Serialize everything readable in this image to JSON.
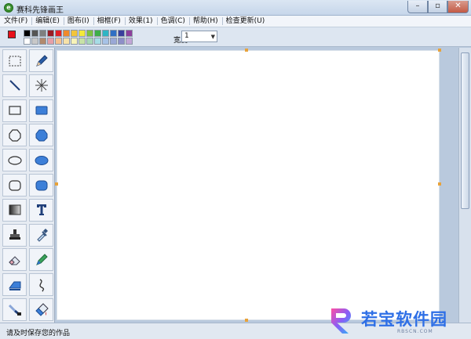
{
  "window": {
    "title": "赛科先锋画王"
  },
  "menu": [
    "文件(F)",
    "编辑(E)",
    "图布(I)",
    "相框(F)",
    "效果(1)",
    "色调(C)",
    "帮助(H)",
    "检查更新(U)"
  ],
  "toolbar": {
    "width_label": "宽度:",
    "width_value": "1",
    "foreground_color": "#e8101a",
    "background_color": "#111111",
    "palette": [
      "#000000",
      "#808080",
      "#800000",
      "#808000",
      "#008000",
      "#008080",
      "#000080",
      "#800080",
      "#808040",
      "#004040",
      "#0080ff",
      "#004080",
      "#8000ff",
      "#804000",
      "#ffffff",
      "#c0c0c0",
      "#ff0000",
      "#ffff00",
      "#00ff00",
      "#00ffff",
      "#0000ff",
      "#ff00ff",
      "#ffff80",
      "#00ff80",
      "#80ffff",
      "#8080ff",
      "#ff0080",
      "#ff8040"
    ],
    "palette_display": [
      "#000000",
      "#555555",
      "#7f7f7f",
      "#9a1c24",
      "#e01f26",
      "#f08a2b",
      "#f3c53a",
      "#f3e93a",
      "#7ec142",
      "#3fae4a",
      "#2fb5c4",
      "#2f6fc4",
      "#3a3f9c",
      "#8c3f9c",
      "#ffffff",
      "#c8c8c8",
      "#b28a6e",
      "#e6a0a8",
      "#f6c18f",
      "#f7e2a8",
      "#f7f3b8",
      "#c7e2a6",
      "#a8d8b8",
      "#a6dde6",
      "#a6c2e6",
      "#9aa8d6",
      "#8e8fc8",
      "#c2a6d6"
    ]
  },
  "tools": [
    {
      "name": "select-rect-tool",
      "icon": "dashed-rect"
    },
    {
      "name": "pencil-tool",
      "icon": "pencil"
    },
    {
      "name": "line-tool",
      "icon": "line"
    },
    {
      "name": "spray-tool",
      "icon": "spray"
    },
    {
      "name": "rectangle-tool",
      "icon": "rect"
    },
    {
      "name": "filled-rectangle-tool",
      "icon": "filled-rect"
    },
    {
      "name": "polygon-tool",
      "icon": "polygon"
    },
    {
      "name": "filled-polygon-tool",
      "icon": "filled-polygon"
    },
    {
      "name": "ellipse-tool",
      "icon": "ellipse"
    },
    {
      "name": "filled-ellipse-tool",
      "icon": "filled-ellipse"
    },
    {
      "name": "rounded-rect-tool",
      "icon": "rounded-rect"
    },
    {
      "name": "filled-rounded-rect-tool",
      "icon": "filled-rounded-rect"
    },
    {
      "name": "gradient-tool",
      "icon": "gradient"
    },
    {
      "name": "text-tool",
      "icon": "text"
    },
    {
      "name": "stamp-tool",
      "icon": "stamp"
    },
    {
      "name": "eyedropper-tool",
      "icon": "eyedropper"
    },
    {
      "name": "eraser-tool",
      "icon": "eraser"
    },
    {
      "name": "color-pen-tool",
      "icon": "color-pen"
    },
    {
      "name": "shape-fill-tool",
      "icon": "shape-fill"
    },
    {
      "name": "curve-tool",
      "icon": "curve"
    },
    {
      "name": "brush-tool",
      "icon": "brush"
    },
    {
      "name": "paint-bucket-tool",
      "icon": "paint-bucket"
    }
  ],
  "status": {
    "text": "请及时保存您的作品"
  },
  "watermark": {
    "name": "若宝软件园",
    "url": "RBSCN.COM"
  }
}
